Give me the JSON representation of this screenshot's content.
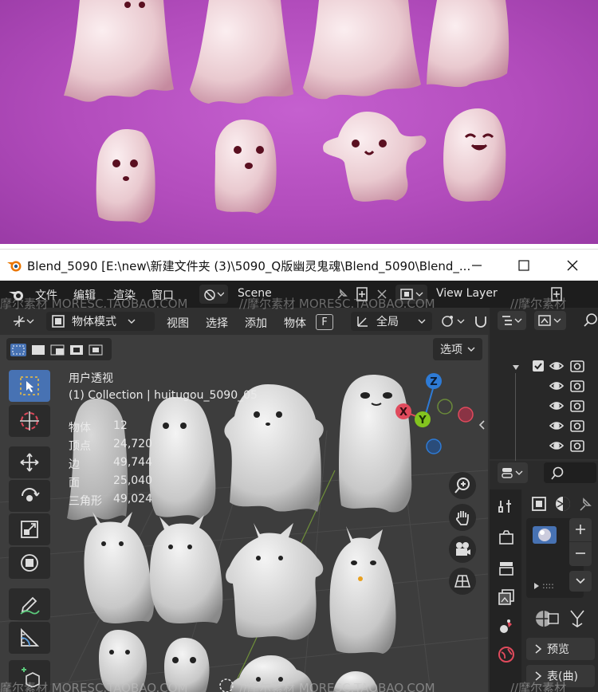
{
  "window": {
    "title": "Blend_5090 [E:\\new\\新建文件夹 (3)\\5090_Q版幽灵鬼魂\\Blend_5090\\Blend_..."
  },
  "menubar": {
    "items": [
      "文件",
      "编辑",
      "渲染",
      "窗口"
    ],
    "scene_label": "Scene",
    "view_layer_label": "View Layer"
  },
  "header": {
    "mode": "物体模式",
    "menus": [
      "视图",
      "选择",
      "添加",
      "物体"
    ],
    "shortcut_key": "F",
    "transform_orientation": "全局",
    "options_label": "选项"
  },
  "viewport": {
    "view_name": "用户透视",
    "collection_info": "(1) Collection | huitugou_5090_05",
    "stats": [
      {
        "label": "物体",
        "value": "12"
      },
      {
        "label": "顶点",
        "value": "24,720"
      },
      {
        "label": "边",
        "value": "49,744"
      },
      {
        "label": "面",
        "value": "25,040"
      },
      {
        "label": "三角形",
        "value": "49,024"
      }
    ],
    "gizmo": {
      "z": "Z",
      "x": "X",
      "y": "Y"
    }
  },
  "properties": {
    "preview_label": "预览",
    "surface_label": "表(曲)",
    "list_dots": "::::"
  },
  "watermarks": [
    "摩尔素材  MORESC.TAOBAO.COM",
    "//摩尔素材  MORESC.TAOBAO.COM",
    "//摩尔素材"
  ],
  "colors": {
    "accent": "#4772b3",
    "preview_bg": "#b24cbc",
    "gizmo_z": "#2e7bd6",
    "gizmo_x": "#e04a5c",
    "gizmo_y": "#83c41f",
    "close_red": "#c8203a"
  }
}
